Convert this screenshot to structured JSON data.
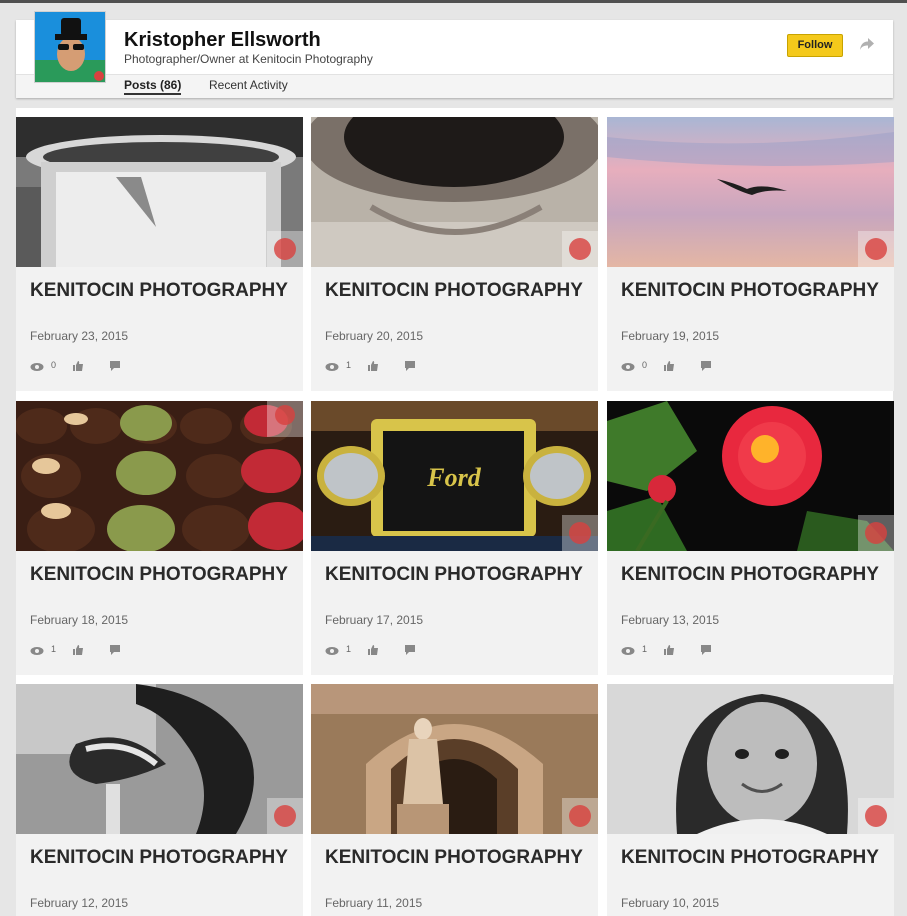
{
  "profile": {
    "name": "Kristopher Ellsworth",
    "headline": "Photographer/Owner at Kenitocin Photography",
    "follow_label": "Follow",
    "tabs": [
      {
        "label": "Posts (86)",
        "active": true
      },
      {
        "label": "Recent Activity",
        "active": false
      }
    ]
  },
  "colors": {
    "follow_button": "#f4c91b",
    "card_bg": "#f2f2f2",
    "title_text": "#2a2a2a"
  },
  "icons": [
    "share-icon",
    "eye-icon",
    "thumbs-up-icon",
    "comment-icon"
  ],
  "posts": [
    {
      "title": "KENITOCIN PHOTOGRAPHY",
      "date": "February 23, 2015",
      "views": "0",
      "image": "white candle jar in black and white"
    },
    {
      "title": "KENITOCIN PHOTOGRAPHY",
      "date": "February 20, 2015",
      "views": "1",
      "image": "dark sepia abstract macro"
    },
    {
      "title": "KENITOCIN PHOTOGRAPHY",
      "date": "February 19, 2015",
      "views": "0",
      "image": "seagull over pastel sky"
    },
    {
      "title": "KENITOCIN PHOTOGRAPHY",
      "date": "February 18, 2015",
      "views": "1",
      "image": "rows of chocolate truffles"
    },
    {
      "title": "KENITOCIN PHOTOGRAPHY",
      "date": "February 17, 2015",
      "views": "1",
      "image": "vintage Ford radiator grille"
    },
    {
      "title": "KENITOCIN PHOTOGRAPHY",
      "date": "February 13, 2015",
      "views": "1",
      "image": "red and yellow rose"
    },
    {
      "title": "KENITOCIN PHOTOGRAPHY",
      "date": "February 12, 2015",
      "views": "",
      "image": "black and white curled leaf"
    },
    {
      "title": "KENITOCIN PHOTOGRAPHY",
      "date": "February 11, 2015",
      "views": "",
      "image": "sepia statue under stone arch"
    },
    {
      "title": "KENITOCIN PHOTOGRAPHY",
      "date": "February 10, 2015",
      "views": "",
      "image": "smiling girl in black and white"
    }
  ]
}
